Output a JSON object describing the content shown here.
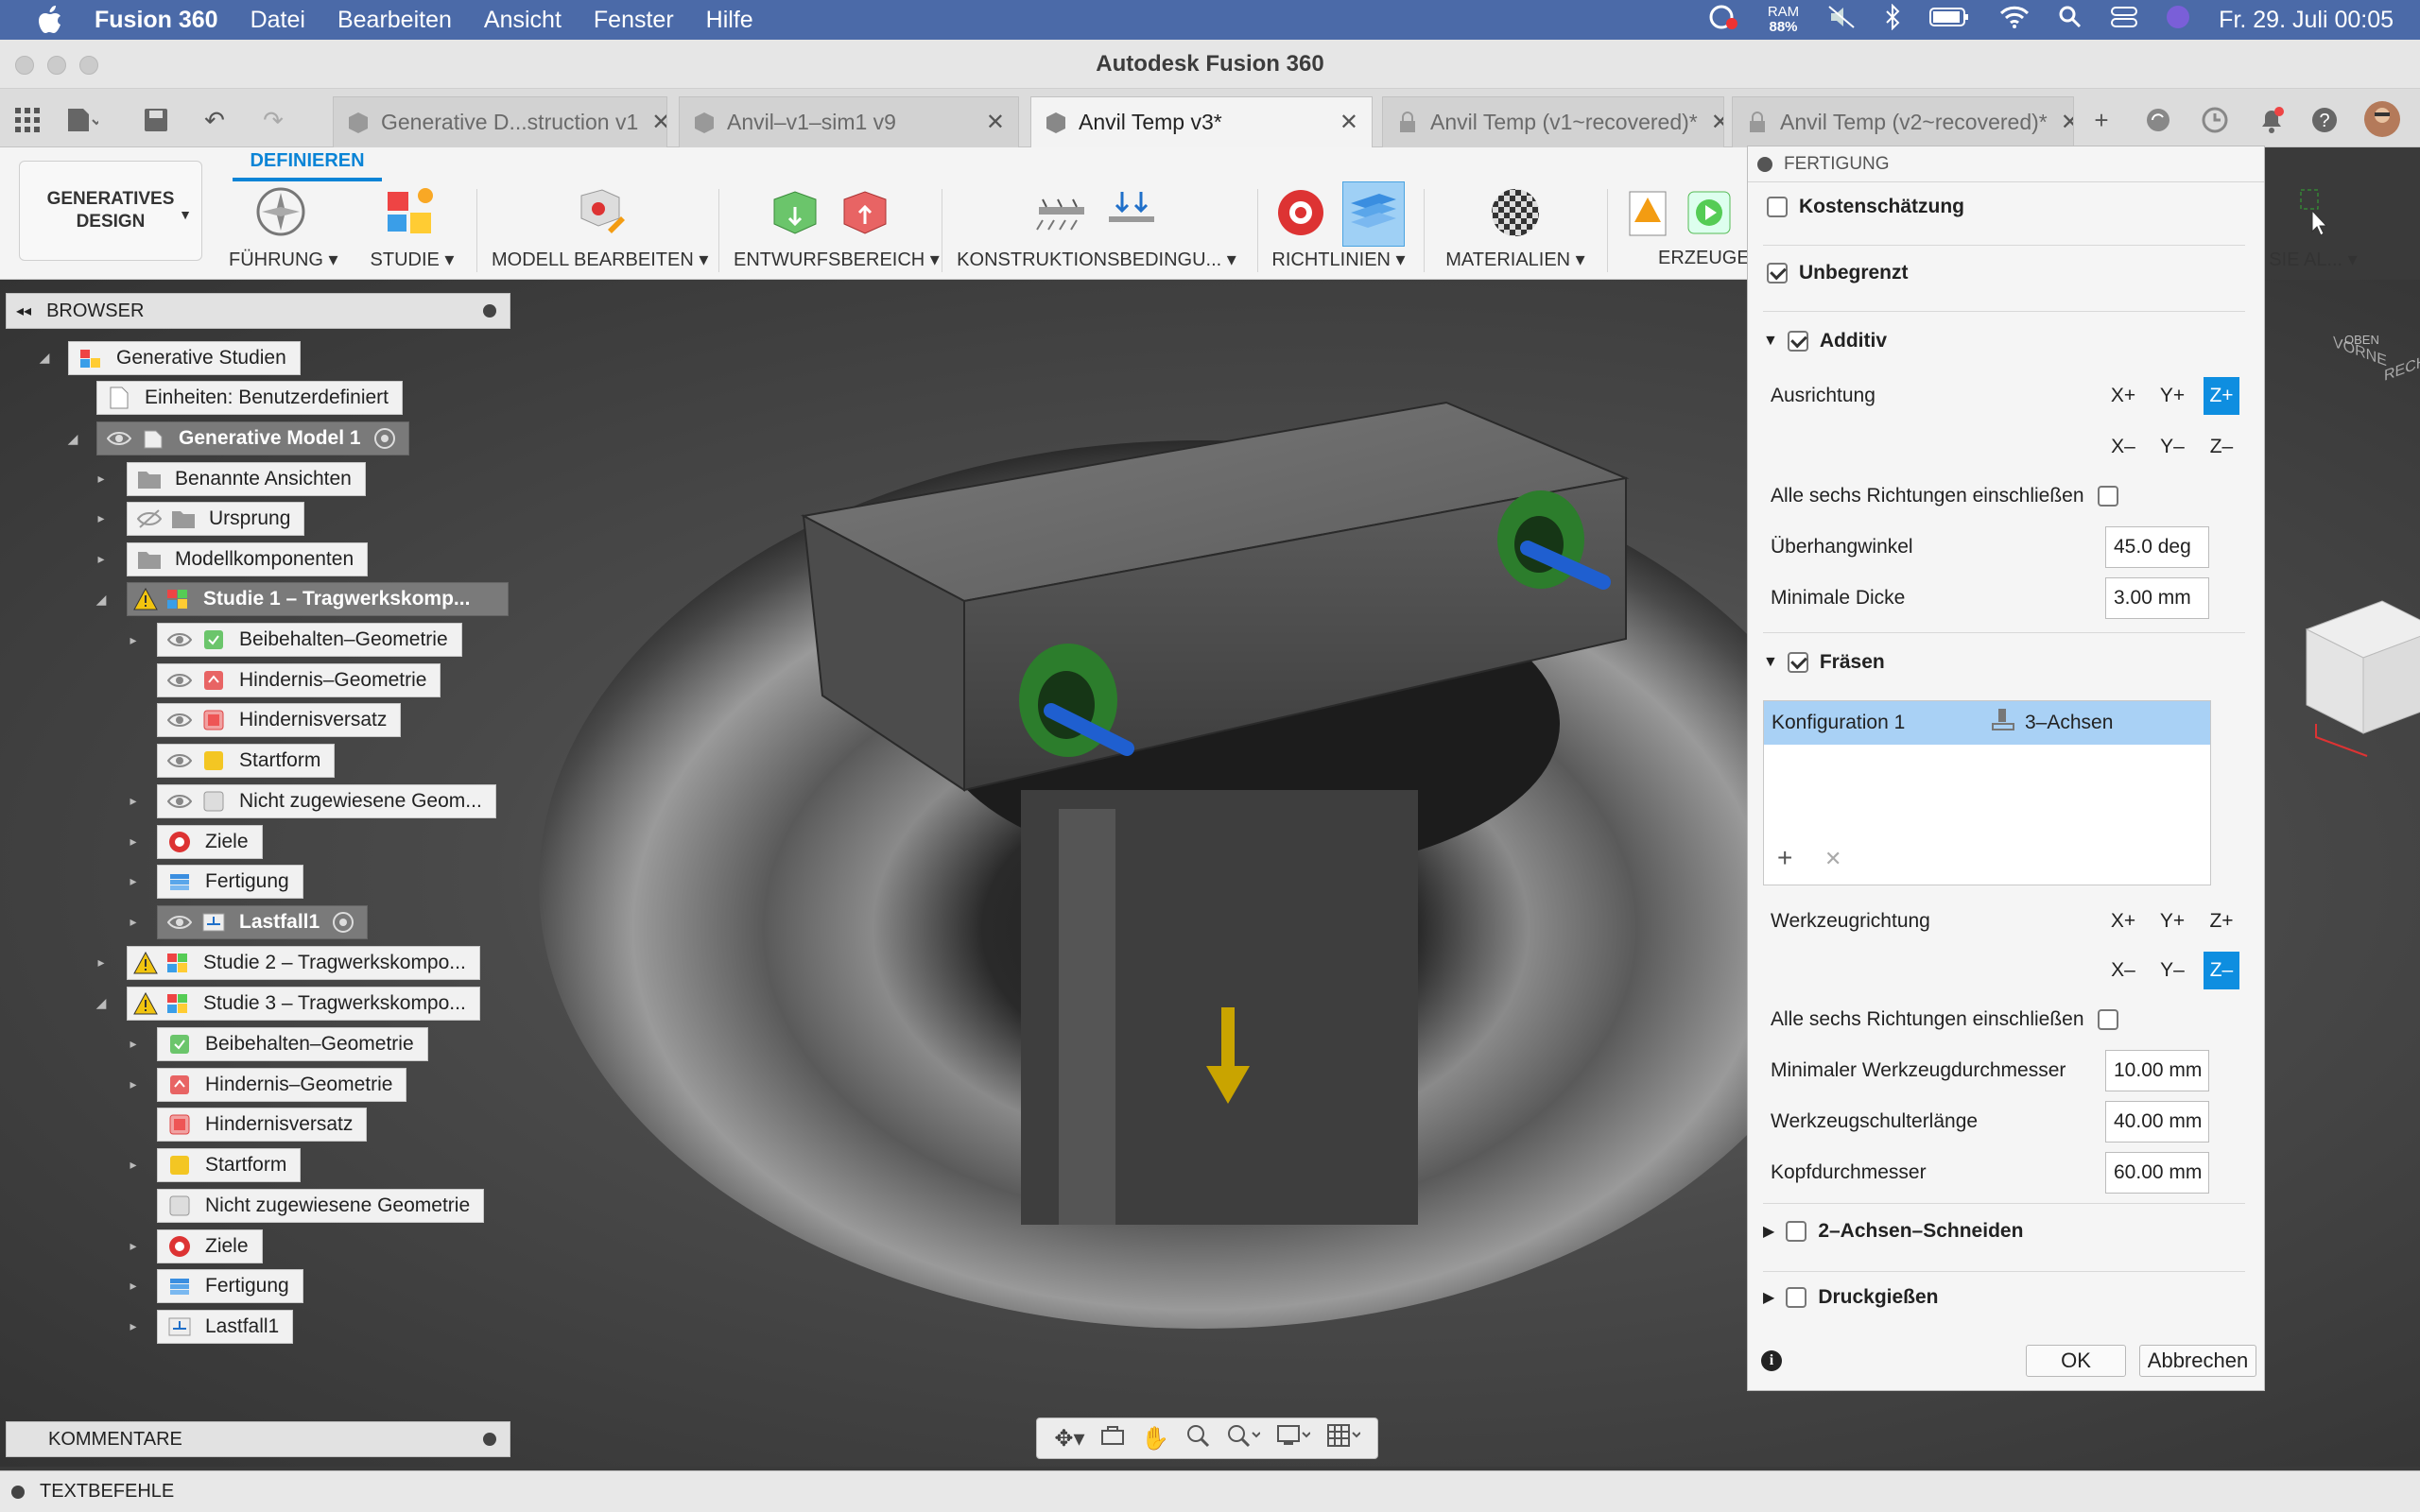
{
  "menubar": {
    "app": "Fusion 360",
    "items": [
      "Datei",
      "Bearbeiten",
      "Ansicht",
      "Fenster",
      "Hilfe"
    ],
    "ram_label": "RAM",
    "ram_value": "88%",
    "datetime": "Fr. 29. Juli  00:05"
  },
  "window": {
    "title": "Autodesk Fusion 360"
  },
  "tabs": [
    {
      "label": "Generative D...struction v1"
    },
    {
      "label": "Anvil–v1–sim1 v9"
    },
    {
      "label": "Anvil Temp v3*"
    },
    {
      "label": "Anvil Temp (v1~recovered)*"
    },
    {
      "label": "Anvil Temp (v2~recovered)*"
    }
  ],
  "toolbar": {
    "workspace_line1": "GENERATIVES",
    "workspace_line2": "DESIGN",
    "active_tab": "DEFINIEREN",
    "groups": [
      "FÜHRUNG",
      "STUDIE",
      "MODELL BEARBEITEN",
      "ENTWURFSBEREICH",
      "KONSTRUKTIONSBEDINGU...",
      "RICHTLINIEN",
      "MATERIALIEN",
      "ERZEUGEN",
      "SIE AL..."
    ]
  },
  "browser": {
    "title": "BROWSER",
    "nodes": [
      "Generative Studien",
      "Einheiten: Benutzerdefiniert",
      "Generative Model 1",
      "Benannte Ansichten",
      "Ursprung",
      "Modellkomponenten",
      "Studie 1 – Tragwerkskomp...",
      "Beibehalten–Geometrie",
      "Hindernis–Geometrie",
      "Hindernisversatz",
      "Startform",
      "Nicht zugewiesene Geom...",
      "Ziele",
      "Fertigung",
      "Lastfall1",
      "Studie 2 – Tragwerkskompo...",
      "Studie 3 – Tragwerkskompo...",
      "Beibehalten–Geometrie",
      "Hindernis–Geometrie",
      "Hindernisversatz",
      "Startform",
      "Nicht zugewiesene Geometrie",
      "Ziele",
      "Fertigung",
      "Lastfall1"
    ]
  },
  "comments": {
    "title": "KOMMENTARE"
  },
  "textbar": {
    "label": "TEXTBEFEHLE"
  },
  "viewcube": {
    "front": "VORNE",
    "right": "RECHTS",
    "top": "OBEN"
  },
  "panel": {
    "title": "FERTIGUNG",
    "cost_label": "Kostenschätzung",
    "cost_checked": false,
    "unlimited_label": "Unbegrenzt",
    "unlimited_checked": true,
    "additive": {
      "label": "Additiv",
      "checked": true,
      "orientation_label": "Ausrichtung",
      "dirs_pos": [
        "X+",
        "Y+",
        "Z+"
      ],
      "dirs_neg": [
        "X–",
        "Y–",
        "Z–"
      ],
      "active": "Z+",
      "all_dirs_label": "Alle sechs Richtungen einschließen",
      "overhang_label": "Überhangwinkel",
      "overhang_value": "45.0 deg",
      "min_thickness_label": "Minimale Dicke",
      "min_thickness_value": "3.00 mm"
    },
    "milling": {
      "label": "Fräsen",
      "checked": true,
      "config_name": "Konfiguration 1",
      "config_type": "3–Achsen",
      "tool_dir_label": "Werkzeugrichtung",
      "dirs_pos": [
        "X+",
        "Y+",
        "Z+"
      ],
      "dirs_neg": [
        "X–",
        "Y–",
        "Z–"
      ],
      "active": "Z–",
      "all_dirs_label": "Alle sechs Richtungen einschließen",
      "min_tool_label": "Minimaler Werkzeugdurchmesser",
      "min_tool_value": "10.00 mm",
      "shoulder_label": "Werkzeugschulterlänge",
      "shoulder_value": "40.00 mm",
      "head_label": "Kopfdurchmesser",
      "head_value": "60.00 mm"
    },
    "two_axis": {
      "label": "2–Achsen–Schneiden",
      "checked": false
    },
    "die_cast": {
      "label": "Druckgießen",
      "checked": false
    },
    "ok": "OK",
    "cancel": "Abbrechen"
  }
}
